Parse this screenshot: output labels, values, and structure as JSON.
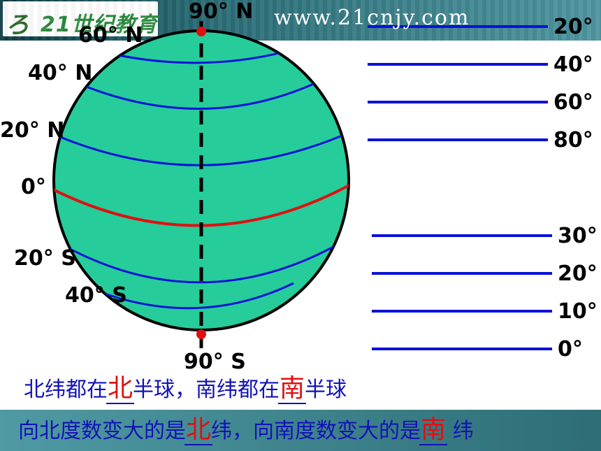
{
  "header": {
    "logo_text": "21世纪教育",
    "url": "www.21cnjy.com"
  },
  "globe": {
    "fill": "#26cc9a",
    "latitude_color": "#0a12d8",
    "equator_color": "#e01010",
    "axis_labels": {
      "north_pole": "90° N",
      "south_pole": "90° S"
    },
    "left_labels": [
      "60° N",
      "40° N",
      "20° N",
      "0°",
      "20° S",
      "40° S"
    ]
  },
  "right_lines": {
    "group_a": [
      "20°",
      "40°",
      "60°",
      "80°"
    ],
    "group_b": [
      "30°",
      "20°",
      "10°",
      "0°"
    ]
  },
  "sentences": {
    "line1": {
      "prefix": "北纬都在",
      "blank1": "北",
      "middle": "半球，南纬都在",
      "blank2": "南",
      "suffix": "半球"
    },
    "line2": {
      "prefix": "向北度数变大的是",
      "blank1": "北",
      "middle": "纬，向南度数变大的是",
      "blank2": "南",
      "suffix": " 纬"
    }
  }
}
